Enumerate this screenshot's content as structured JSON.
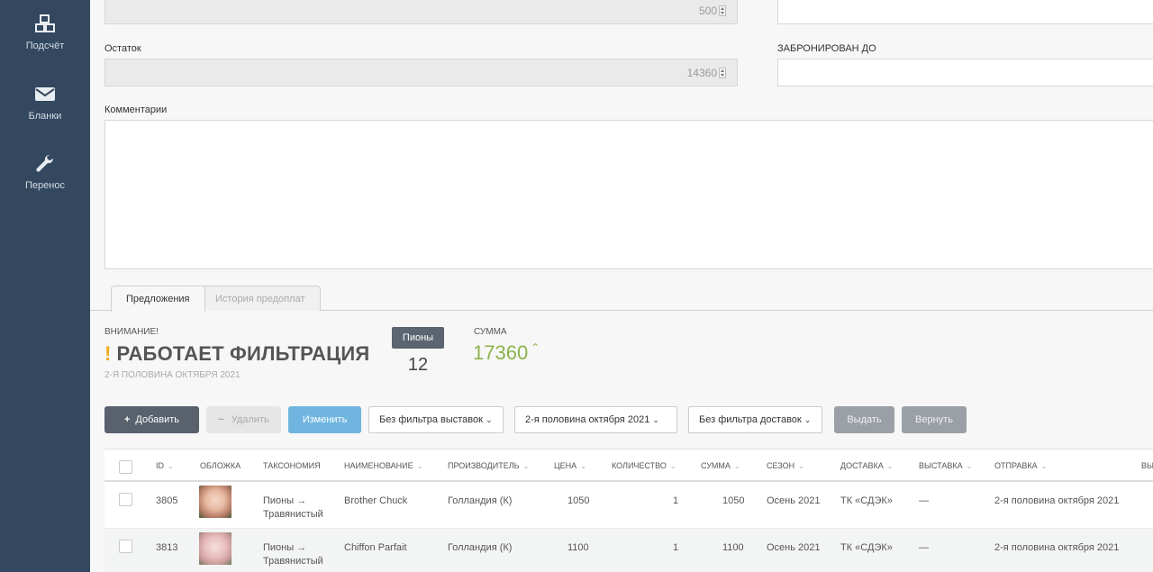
{
  "sidebar": {
    "items": [
      {
        "label": "Подсчёт",
        "icon": "cubes-icon"
      },
      {
        "label": "Бланки",
        "icon": "envelope-icon"
      },
      {
        "label": "Перенос",
        "icon": "wrench-icon"
      }
    ]
  },
  "form": {
    "top_value": "500",
    "remainder_label": "Остаток",
    "remainder_value": "14360",
    "reserved_label": "ЗАБРОНИРОВАН ДО",
    "reserved_value": "",
    "comments_label": "Комментарии",
    "comments_value": ""
  },
  "tabs": [
    {
      "label": "Предложения",
      "active": true
    },
    {
      "label": "История предоплат",
      "active": false
    }
  ],
  "summary": {
    "attention": "ВНИМАНИЕ!",
    "filter_title": "РАБОТАЕТ ФИЛЬТРАЦИЯ",
    "filter_sub": "2-Я ПОЛОВИНА ОКТЯБРЯ 2021",
    "group_label": "Пионы",
    "group_count": "12",
    "sum_label": "СУММА",
    "sum_value": "17360",
    "sum_color": "#8cb24a"
  },
  "toolbar": {
    "add": "Добавить",
    "delete": "Удалить",
    "edit": "Изменить",
    "filter_exhibitions": "Без фильтра выставок",
    "filter_period": "2-я половина октября 2021",
    "filter_delivery": "Без фильтра доставок",
    "give": "Выдать",
    "return": "Вернуть"
  },
  "table": {
    "columns": [
      "ID",
      "ОБЛОЖКА",
      "ТАКСОНОМИЯ",
      "НАИМЕНОВАНИЕ",
      "ПРОИЗВОДИТЕЛЬ",
      "ЦЕНА",
      "КОЛИЧЕСТВО",
      "СУММА",
      "СЕЗОН",
      "ДОСТАВКА",
      "ВЫСТАВКА",
      "ОТПРАВКА",
      "ВЫ"
    ],
    "rows": [
      {
        "id": "3805",
        "tax1": "Пионы →",
        "tax2": "Травянистый",
        "name": "Brother Chuck",
        "maker": "Голландия (К)",
        "price": "1050",
        "qty": "1",
        "sum": "1050",
        "season": "Осень 2021",
        "delivery": "ТК «СДЭК»",
        "exhibit": "—",
        "ship": "2-я половина октября 2021"
      },
      {
        "id": "3813",
        "tax1": "Пионы →",
        "tax2": "Травянистый",
        "name": "Chiffon Parfait",
        "maker": "Голландия (К)",
        "price": "1100",
        "qty": "1",
        "sum": "1100",
        "season": "Осень 2021",
        "delivery": "ТК «СДЭК»",
        "exhibit": "—",
        "ship": "2-я половина октября 2021"
      }
    ]
  }
}
